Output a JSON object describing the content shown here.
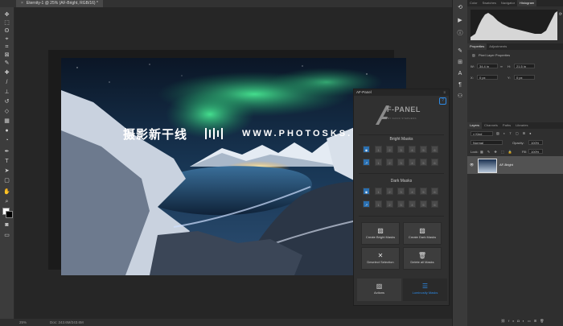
{
  "document": {
    "tab_title": "Eternity-1 @ 25% (AF-Bright, RGB/16) *",
    "close_glyph": "×"
  },
  "status": {
    "zoom": "25%",
    "doc_info": "Doc: 243.6M/243.6M"
  },
  "watermark": {
    "chinese": "摄影新干线",
    "url": "WWW.PHOTOSKS.VIP"
  },
  "toolbar": {
    "tools": [
      "move-tool",
      "artboard-tool",
      "lasso-tool",
      "quick-select-tool",
      "crop-tool",
      "frame-tool",
      "eyedropper-tool",
      "healing-tool",
      "brush-tool",
      "stamp-tool",
      "history-brush-tool",
      "eraser-tool",
      "gradient-tool",
      "blur-tool",
      "dodge-tool",
      "pen-tool",
      "type-tool",
      "path-select-tool",
      "rectangle-tool",
      "hand-tool",
      "zoom-tool",
      "more-tools"
    ],
    "foreground_color": "#ffffff",
    "background_color": "#000000"
  },
  "af_panel": {
    "title": "AF-Panel",
    "logo_text": "F-PANEL",
    "logo_subtitle": "BY DAVID STEPHENS",
    "help_glyph": "?",
    "bright_masks_title": "Bright Masks",
    "dark_masks_title": "Dark Masks",
    "mask_levels": [
      "1",
      "2",
      "3",
      "4",
      "5",
      "6"
    ],
    "buttons": {
      "create_bright": "Create Bright Masks",
      "create_dark": "Create Dark Masks",
      "deselect": "Deselect Selection",
      "delete_all": "Delete all Masks"
    },
    "tabs": {
      "actions": "Actions",
      "luminosity": "Luminosity Masks"
    },
    "accent": "#2d8ae6"
  },
  "right_panels": {
    "histogram_tabs": [
      "Color",
      "Swatches",
      "Navigator",
      "Histogram"
    ],
    "active_histogram_tab": "Histogram",
    "properties_tabs": [
      "Properties",
      "Adjustments"
    ],
    "properties_subtitle": "Pixel Layer Properties",
    "props": {
      "w_label": "W:",
      "w": "34.4 in",
      "h_label": "H:",
      "h": "21.5 in",
      "x_label": "X:",
      "x": "0 px",
      "y_label": "Y:",
      "y": "0 px",
      "link_glyph": "∞"
    },
    "layers_tabs": [
      "Layers",
      "Channels",
      "Paths",
      "Libraries"
    ],
    "kind_label": "Kind",
    "blend_mode": "Normal",
    "opacity_label": "Opacity:",
    "opacity": "100%",
    "lock_label": "Lock:",
    "fill_label": "Fill:",
    "fill": "100%",
    "layer_name": "AF-Bright",
    "footer_icons": [
      "link-icon",
      "fx-icon",
      "mask-icon",
      "adjustment-icon",
      "group-icon",
      "new-layer-icon",
      "trash-icon"
    ],
    "footer_glyphs": [
      "⛓",
      "fx",
      "◘",
      "◐",
      "▭",
      "⊞",
      "🗑"
    ]
  }
}
